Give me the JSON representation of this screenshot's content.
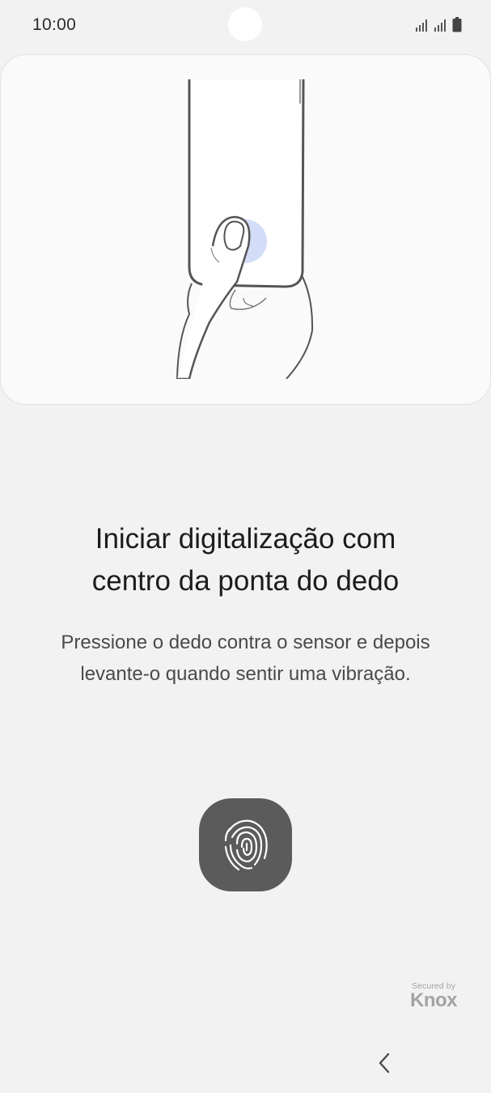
{
  "status_bar": {
    "time": "10:00",
    "icons": [
      "signal-icon",
      "signal-icon",
      "battery-icon"
    ]
  },
  "illustration": {
    "icon": "finger-on-sensor-illustration"
  },
  "main": {
    "title_line1": "Iniciar digitalização com",
    "title_line2": "centro da ponta do dedo",
    "description_line1": "Pressione o dedo contra o sensor e depois",
    "description_line2": "levante-o quando sentir uma vibração."
  },
  "fingerprint_button": {
    "icon": "fingerprint-icon"
  },
  "branding": {
    "secured_by": "Secured by",
    "knox": "Knox"
  },
  "navigation": {
    "back_icon": "chevron-left-icon"
  },
  "colors": {
    "background": "#f2f2f2",
    "card": "#fafafa",
    "fingerprint_button": "#5b5b5b",
    "knox_logo": "#a3a3a3",
    "sensor_highlight": "#c8d4f5"
  }
}
